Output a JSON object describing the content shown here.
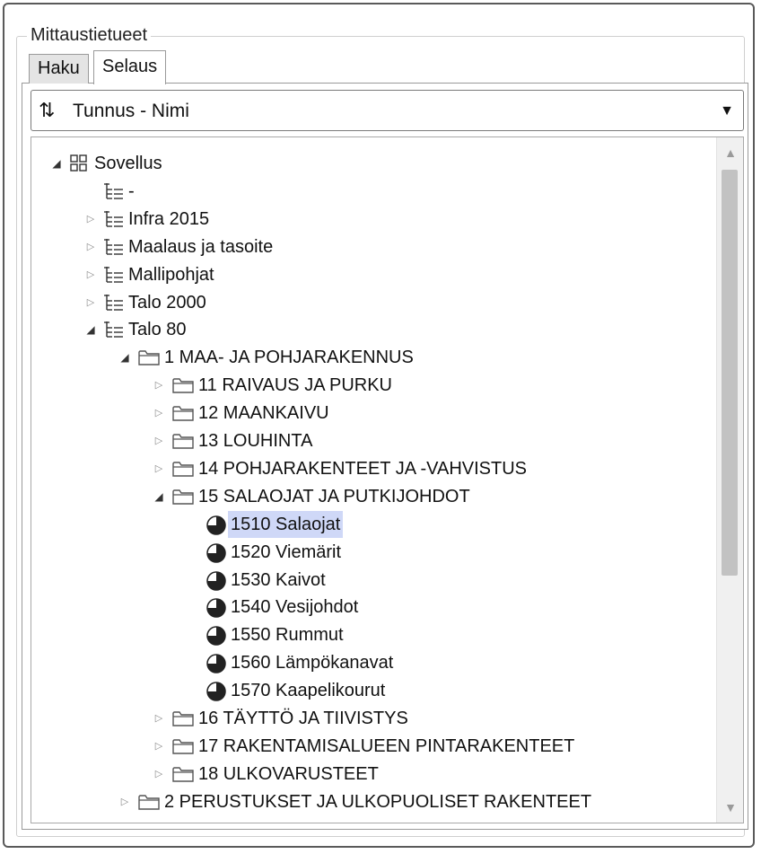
{
  "groupbox": {
    "title": "Mittaustietueet"
  },
  "tabs": [
    {
      "label": "Haku",
      "active": false
    },
    {
      "label": "Selaus",
      "active": true
    }
  ],
  "sort_combo": {
    "icon": "sort-arrows-icon",
    "value": "Tunnus - Nimi"
  },
  "tree": {
    "items": [
      {
        "label": "Sovellus",
        "level": 0,
        "expander": "expanded",
        "icon": "grid-icon"
      },
      {
        "label": "-",
        "level": 1,
        "expander": "none",
        "icon": "tree-list-icon"
      },
      {
        "label": "Infra 2015",
        "level": 1,
        "expander": "collapsed",
        "icon": "tree-list-icon"
      },
      {
        "label": "Maalaus ja tasoite",
        "level": 1,
        "expander": "collapsed",
        "icon": "tree-list-icon"
      },
      {
        "label": "Mallipohjat",
        "level": 1,
        "expander": "collapsed",
        "icon": "tree-list-icon"
      },
      {
        "label": "Talo 2000",
        "level": 1,
        "expander": "collapsed",
        "icon": "tree-list-icon"
      },
      {
        "label": "Talo 80",
        "level": 1,
        "expander": "expanded",
        "icon": "tree-list-icon"
      },
      {
        "label": "1 MAA- JA POHJARAKENNUS",
        "level": 2,
        "expander": "expanded",
        "icon": "folder-icon"
      },
      {
        "label": "11 RAIVAUS JA PURKU",
        "level": 3,
        "expander": "collapsed",
        "icon": "folder-icon"
      },
      {
        "label": "12 MAANKAIVU",
        "level": 3,
        "expander": "collapsed",
        "icon": "folder-icon"
      },
      {
        "label": "13 LOUHINTA",
        "level": 3,
        "expander": "collapsed",
        "icon": "folder-icon"
      },
      {
        "label": "14 POHJARAKENTEET JA -VAHVISTUS",
        "level": 3,
        "expander": "collapsed",
        "icon": "folder-icon"
      },
      {
        "label": "15 SALAOJAT JA PUTKIJOHDOT",
        "level": 3,
        "expander": "expanded",
        "icon": "folder-icon"
      },
      {
        "label": "1510 Salaojat",
        "level": 4,
        "expander": "none",
        "icon": "pie-icon",
        "selected": true
      },
      {
        "label": "1520 Viemärit",
        "level": 4,
        "expander": "none",
        "icon": "pie-icon"
      },
      {
        "label": "1530 Kaivot",
        "level": 4,
        "expander": "none",
        "icon": "pie-icon"
      },
      {
        "label": "1540 Vesijohdot",
        "level": 4,
        "expander": "none",
        "icon": "pie-icon"
      },
      {
        "label": "1550 Rummut",
        "level": 4,
        "expander": "none",
        "icon": "pie-icon"
      },
      {
        "label": "1560 Lämpökanavat",
        "level": 4,
        "expander": "none",
        "icon": "pie-icon"
      },
      {
        "label": "1570 Kaapelikourut",
        "level": 4,
        "expander": "none",
        "icon": "pie-icon"
      },
      {
        "label": "16 TÄYTTÖ JA TIIVISTYS",
        "level": 3,
        "expander": "collapsed",
        "icon": "folder-icon"
      },
      {
        "label": "17 RAKENTAMISALUEEN PINTARAKENTEET",
        "level": 3,
        "expander": "collapsed",
        "icon": "folder-icon"
      },
      {
        "label": "18 ULKOVARUSTEET",
        "level": 3,
        "expander": "collapsed",
        "icon": "folder-icon"
      },
      {
        "label": "2 PERUSTUKSET JA ULKOPUOLISET RAKENTEET",
        "level": 2,
        "expander": "collapsed",
        "icon": "folder-icon"
      }
    ]
  },
  "colors": {
    "selection": "#cfd8f7",
    "scroll_thumb": "#c2c2c2",
    "border": "#9a9a9a"
  }
}
